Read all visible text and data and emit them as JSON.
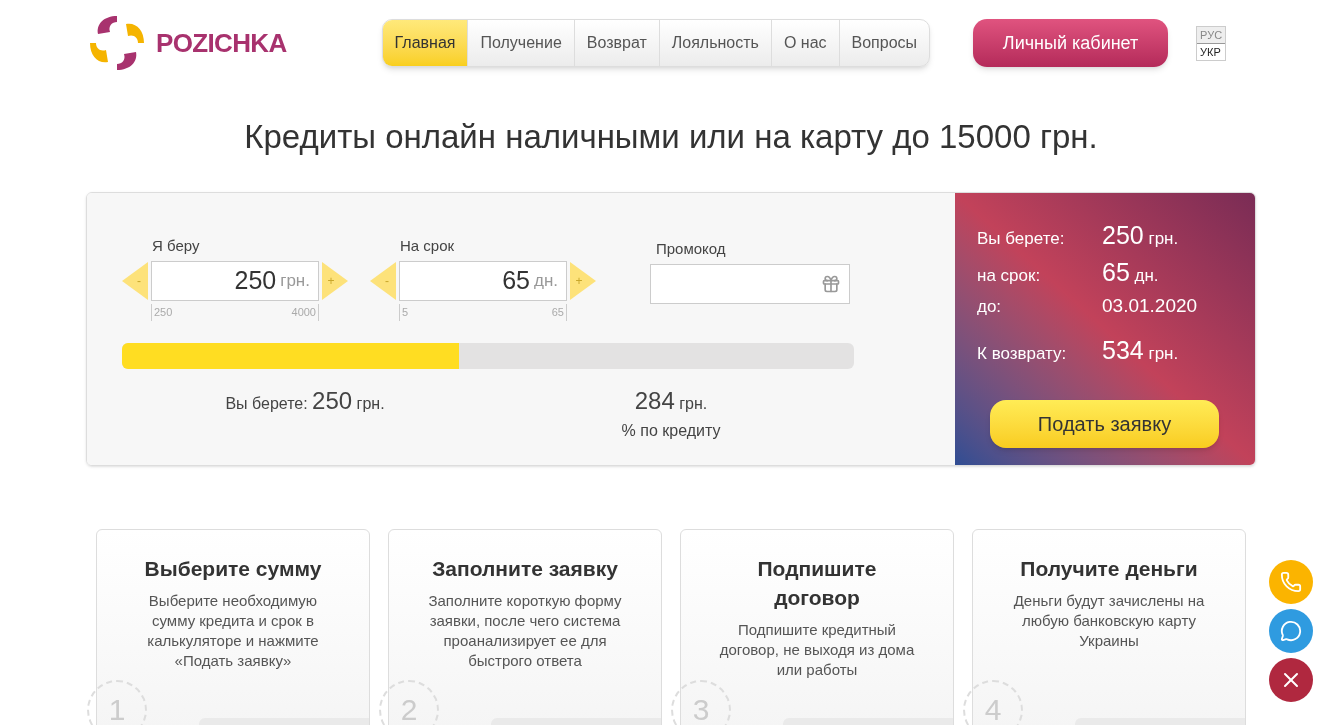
{
  "logo": {
    "text": "POZICHKA"
  },
  "nav": [
    {
      "label": "Главная",
      "selected": true
    },
    {
      "label": "Получение",
      "selected": false
    },
    {
      "label": "Возврат",
      "selected": false
    },
    {
      "label": "Лояльность",
      "selected": false
    },
    {
      "label": "О нас",
      "selected": false
    },
    {
      "label": "Вопросы",
      "selected": false
    }
  ],
  "account_button": "Личный кабинет",
  "languages": [
    {
      "label": "РУС",
      "selected": false
    },
    {
      "label": "УКР",
      "selected": true
    }
  ],
  "headline": "Кредиты онлайн наличными или на карту до 15000 грн.",
  "calculator": {
    "steppers": [
      {
        "label": "Я беру",
        "value": "250",
        "unit": "грн.",
        "min": "250",
        "max": "4000",
        "minus": "-",
        "plus": "+"
      },
      {
        "label": "На срок",
        "value": "65",
        "unit": "дн.",
        "min": "5",
        "max": "65",
        "minus": "-",
        "plus": "+"
      }
    ],
    "promo": {
      "label": "Промокод"
    },
    "slider": {
      "level": 0.46
    },
    "take": {
      "label": "Вы берете:",
      "value": "250",
      "unit": "грн."
    },
    "interest": {
      "value": "284",
      "unit": "грн.",
      "caption": "% по кредиту"
    },
    "summary": [
      {
        "label": "Вы берете:",
        "value": "250",
        "unit": "грн."
      },
      {
        "label": "на срок:",
        "value": "65",
        "unit": "дн."
      },
      {
        "label": "до:",
        "value": "03.01.2020"
      },
      {
        "label": "К возврату:",
        "value": "534",
        "unit": "грн."
      }
    ],
    "submit": "Подать заявку"
  },
  "steps": [
    {
      "number": "1",
      "title": "Выберите сумму",
      "text": "Выберите необходимую сумму кредита и срок в калькуляторе и нажмите «Подать заявку»"
    },
    {
      "number": "2",
      "title": "Заполните заявку",
      "text": "Заполните короткую форму заявки, после чего система проанализирует ее для быстрого ответа"
    },
    {
      "number": "3",
      "title": "Подпишите договор",
      "text": "Подпишите кредитный договор, не выходя из дома или работы"
    },
    {
      "number": "4",
      "title": "Получите деньги",
      "text": "Деньги будут зачислены на любую банковскую карту Украины"
    }
  ],
  "float_buttons": [
    {
      "kind": "phone"
    },
    {
      "kind": "chat"
    },
    {
      "kind": "close"
    }
  ]
}
